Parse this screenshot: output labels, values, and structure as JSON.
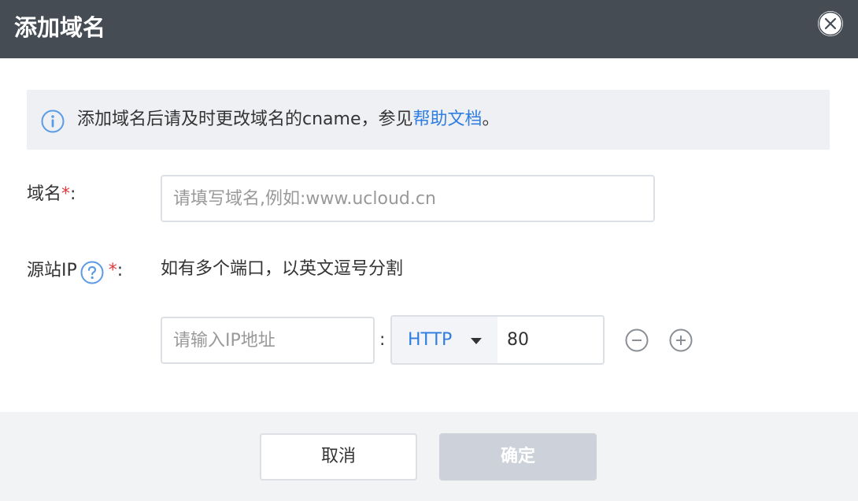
{
  "dialog": {
    "title": "添加域名",
    "close_icon": "close-icon"
  },
  "notice": {
    "icon": "info-icon",
    "text": "添加域名后请及时更改域名的cname，参见",
    "link_text": "帮助文档",
    "suffix": "。"
  },
  "domain": {
    "label": "域名",
    "required_mark": "*",
    "colon": ":",
    "placeholder": "请填写域名,例如:www.ucloud.cn",
    "value": ""
  },
  "origin_ip": {
    "label": "源站IP",
    "help_icon": "question-icon",
    "required_mark": "*",
    "colon": ":",
    "hint": "如有多个端口，以英文逗号分割",
    "ip_placeholder": "请输入IP地址",
    "separator": ":",
    "protocol": "HTTP",
    "port": "80",
    "remove_icon": "minus-circle-icon",
    "add_icon": "plus-circle-icon"
  },
  "footer": {
    "cancel_label": "取消",
    "confirm_label": "确定"
  },
  "colors": {
    "header_bg": "#464c54",
    "link": "#2f7de1",
    "required": "#e03a3a",
    "disabled_button": "#cdd2da"
  }
}
